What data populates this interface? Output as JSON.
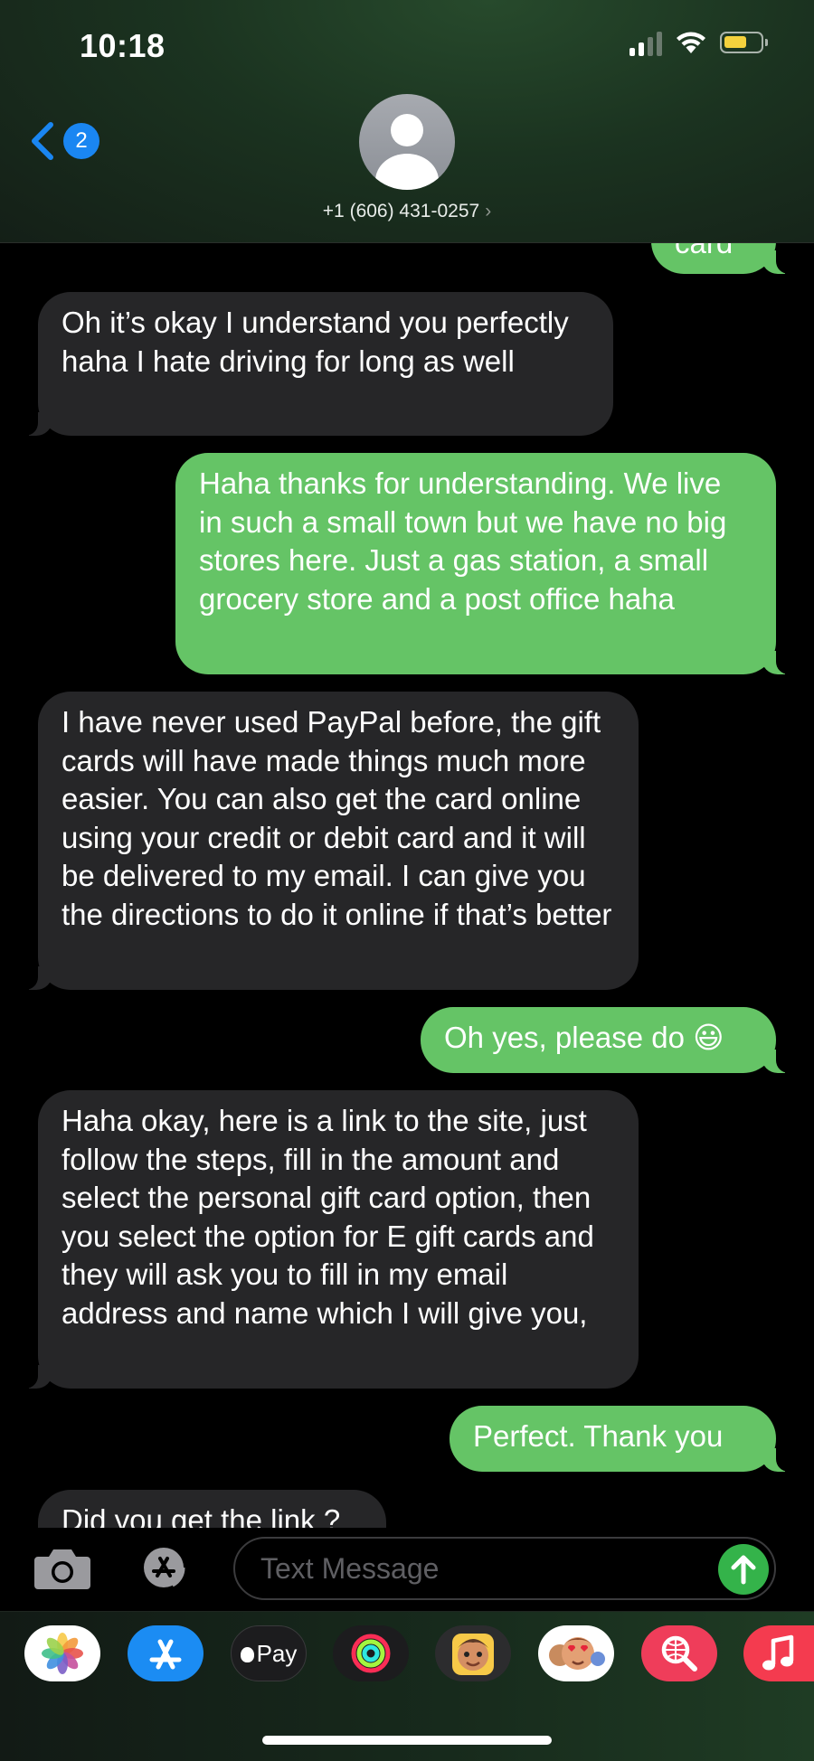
{
  "status_bar": {
    "time": "10:18"
  },
  "header": {
    "back_badge": "2",
    "contact": "+1 (606) 431-0257",
    "contact_chevron": "›"
  },
  "messages": [
    {
      "direction": "outgoing",
      "text": "card"
    },
    {
      "direction": "incoming",
      "text": "Oh it’s okay I understand you perfectly haha I hate driving for long as well"
    },
    {
      "direction": "outgoing",
      "text": "Haha thanks for understanding. We live in such a small town but we have no big stores here. Just a gas station, a small grocery store and a post office haha"
    },
    {
      "direction": "incoming",
      "text": "I have never used PayPal before, the gift cards will have made things much more easier. You can also get the card online using your credit or debit card and it will be delivered to my email. I can give you the directions to do it online if that’s better"
    },
    {
      "direction": "outgoing",
      "text": "Oh yes, please do 😃"
    },
    {
      "direction": "incoming",
      "text": "Haha okay, here is a link to the site, just follow the steps, fill in the amount and select the personal gift card option, then you select the option for E gift cards and they will ask you to fill in my email address and name which I will give you,"
    },
    {
      "direction": "outgoing",
      "text": "Perfect. Thank you"
    },
    {
      "direction": "incoming",
      "text": "Did you get the link ?"
    }
  ],
  "input": {
    "placeholder": "Text Message"
  },
  "apps": {
    "photos": "photos-icon",
    "app_store": "app-store-icon",
    "apple_pay_label": "Pay",
    "activity": "activity-icon",
    "memoji": "memoji-icon",
    "stickers": "stickers-icon",
    "search": "image-search-icon",
    "music": "music-icon"
  },
  "colors": {
    "outgoing_bubble": "#65c466",
    "incoming_bubble": "#262628",
    "accent_blue": "#1a86f2"
  }
}
